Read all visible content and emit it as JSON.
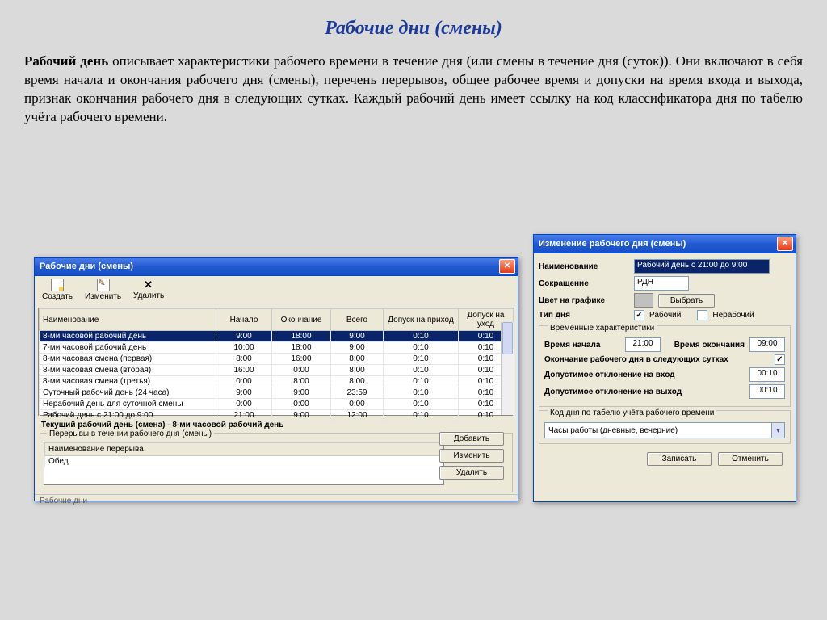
{
  "page": {
    "title": "Рабочие дни (смены)",
    "intro_bold": "Рабочий день",
    "intro_rest": " описывает характеристики рабочего времени в течение дня (или смены в течение дня (суток)). Они включают в себя время начала и окончания рабочего дня (смены), перечень перерывов, общее рабочее время и допуски на время входа и выхода, признак окончания рабочего дня в следующих сутках. Каждый рабочий день имеет ссылку на код классификатора дня по табелю учёта рабочего времени."
  },
  "list_window": {
    "title": "Рабочие дни (смены)",
    "toolbar": {
      "create": "Создать",
      "edit": "Изменить",
      "delete": "Удалить"
    },
    "columns": [
      "Наименование",
      "Начало",
      "Окончание",
      "Всего",
      "Допуск на приход",
      "Допуск на уход"
    ],
    "rows": [
      {
        "name": "8-ми часовой рабочий день",
        "start": "9:00",
        "end": "18:00",
        "total": "9:00",
        "in": "0:10",
        "out": "0:10",
        "selected": true
      },
      {
        "name": "7-ми часовой рабочий день",
        "start": "10:00",
        "end": "18:00",
        "total": "9:00",
        "in": "0:10",
        "out": "0:10"
      },
      {
        "name": "8-ми часовая смена (первая)",
        "start": "8:00",
        "end": "16:00",
        "total": "8:00",
        "in": "0:10",
        "out": "0:10"
      },
      {
        "name": "8-ми часовая смена (вторая)",
        "start": "16:00",
        "end": "0:00",
        "total": "8:00",
        "in": "0:10",
        "out": "0:10"
      },
      {
        "name": "8-ми часовая смена (третья)",
        "start": "0:00",
        "end": "8:00",
        "total": "8:00",
        "in": "0:10",
        "out": "0:10"
      },
      {
        "name": "Суточный рабочий день (24 часа)",
        "start": "9:00",
        "end": "9:00",
        "total": "23:59",
        "in": "0:10",
        "out": "0:10"
      },
      {
        "name": "Нерабочий день для суточной смены",
        "start": "0:00",
        "end": "0:00",
        "total": "0:00",
        "in": "0:10",
        "out": "0:10"
      },
      {
        "name": "Рабочий день с 21:00 до 9:00",
        "start": "21:00",
        "end": "9:00",
        "total": "12:00",
        "in": "0:10",
        "out": "0:10"
      }
    ],
    "current_label": "Текущий рабочий день (смена) - 8-ми часовой рабочий день",
    "breaks_legend": "Перерывы в течении рабочего дня (смены)",
    "break_col": "Наименование перерыва",
    "break_row": "Обед",
    "btn_add": "Добавить",
    "btn_edit": "Изменить",
    "btn_del": "Удалить",
    "status": "Рабочие дни"
  },
  "edit_window": {
    "title": "Изменение рабочего дня (смены)",
    "lbl_name": "Наименование",
    "val_name": "Рабочий день с 21:00 до 9:00",
    "lbl_abbr": "Сокращение",
    "val_abbr": "РДН",
    "lbl_color": "Цвет на графике",
    "btn_color": "Выбрать",
    "lbl_type": "Тип дня",
    "chk_work": "Рабочий",
    "chk_nonwork": "Нерабочий",
    "group_time": "Временные характеристики",
    "lbl_start": "Время начала",
    "val_start": "21:00",
    "lbl_end": "Время окончания",
    "val_end": "09:00",
    "lbl_nextday": "Окончание рабочего дня в следующих сутках",
    "lbl_tol_in": "Допустимое отклонение на вход",
    "val_tol_in": "00:10",
    "lbl_tol_out": "Допустимое отклонение на выход",
    "val_tol_out": "00:10",
    "group_code": "Код дня по табелю учёта рабочего времени",
    "combo_value": "Часы работы (дневные, вечерние)",
    "btn_save": "Записать",
    "btn_cancel": "Отменить"
  }
}
